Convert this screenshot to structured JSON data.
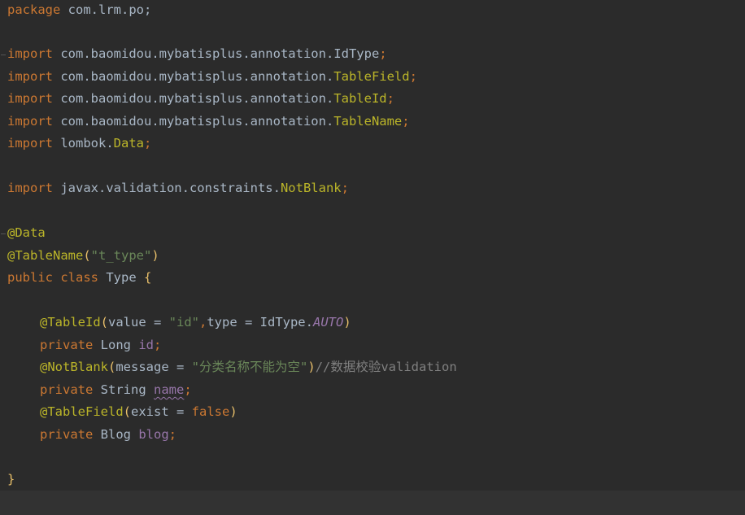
{
  "editor": {
    "language": "java",
    "lines": {
      "l1_kw": "package",
      "l1_rest": " com.lrm.po;",
      "l3_kw": "import",
      "l3_pkg": " com.baomidou.mybatisplus.annotation.",
      "l3_cls": "IdType",
      "l4_kw": "import",
      "l4_pkg": " com.baomidou.mybatisplus.annotation.",
      "l4_cls": "TableField",
      "l5_kw": "import",
      "l5_pkg": " com.baomidou.mybatisplus.annotation.",
      "l5_cls": "TableId",
      "l6_kw": "import",
      "l6_pkg": " com.baomidou.mybatisplus.annotation.",
      "l6_cls": "TableName",
      "l7_kw": "import",
      "l7_pkg": " lombok.",
      "l7_cls": "Data",
      "l9_kw": "import",
      "l9_pkg": " javax.validation.constraints.",
      "l9_cls": "NotBlank",
      "semicolon": ";",
      "l11_ann": "@Data",
      "l12_ann": "@TableName",
      "l12_open": "(",
      "l12_str": "\"t_type\"",
      "l12_close": ")",
      "l13_kw1": "public",
      "l13_kw2": "class",
      "l13_name": " Type ",
      "l13_brace": "{",
      "l15_ann": "@TableId",
      "l15_open": "(",
      "l15_arg1": "value = ",
      "l15_str": "\"id\"",
      "l15_comma": ",",
      "l15_arg2": "type = IdType.",
      "l15_const": "AUTO",
      "l15_close": ")",
      "l16_kw": "private",
      "l16_type": " Long ",
      "l16_field": "id",
      "l17_ann": "@NotBlank",
      "l17_open": "(",
      "l17_arg": "message = ",
      "l17_str": "\"分类名称不能为空\"",
      "l17_close": ")",
      "l17_comment": "//数据校验validation",
      "l18_kw": "private",
      "l18_type": " String ",
      "l18_field": "name",
      "l19_ann": "@TableField",
      "l19_open": "(",
      "l19_arg": "exist = ",
      "l19_kw": "false",
      "l19_close": ")",
      "l20_kw": "private",
      "l20_type": " Blog ",
      "l20_field": "blog",
      "l22_brace": "}"
    }
  },
  "colors": {
    "background": "#2b2b2b",
    "keyword": "#cc7832",
    "annotation": "#bbb529",
    "string": "#6a8759",
    "field": "#9876aa",
    "comment": "#808080",
    "text": "#a9b7c6"
  }
}
